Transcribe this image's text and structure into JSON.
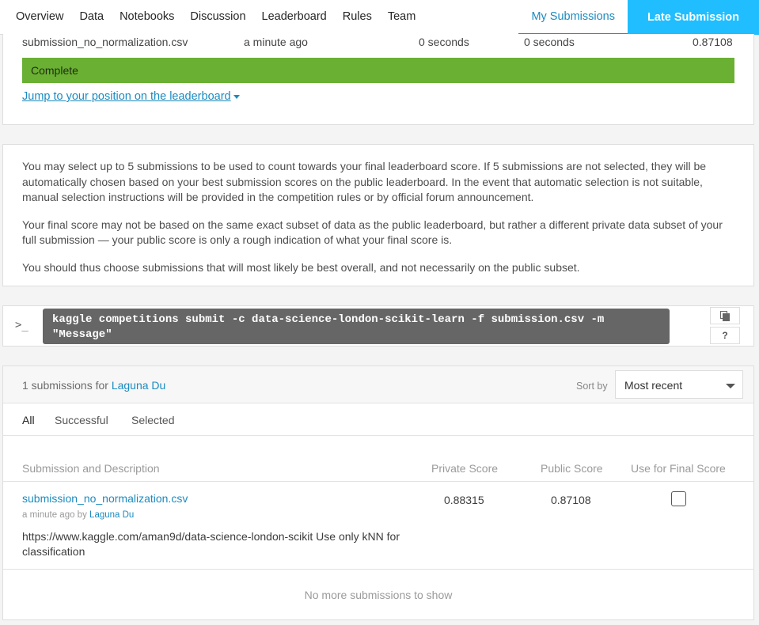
{
  "nav": {
    "tabs": [
      "Overview",
      "Data",
      "Notebooks",
      "Discussion",
      "Leaderboard",
      "Rules",
      "Team"
    ],
    "my_submissions": "My Submissions",
    "late_submission": "Late Submission"
  },
  "latest": {
    "filename": "submission_no_normalization.csv",
    "time": "a minute ago",
    "duration1": "0 seconds",
    "duration2": "0 seconds",
    "score": "0.87108",
    "status": "Complete",
    "jump_link": "Jump to your position on the leaderboard"
  },
  "info": {
    "p1": "You may select up to 5 submissions to be used to count towards your final leaderboard score. If 5 submissions are not selected, they will be automatically chosen based on your best submission scores on the public leaderboard. In the event that automatic selection is not suitable, manual selection instructions will be provided in the competition rules or by official forum announcement.",
    "p2": "Your final score may not be based on the same exact subset of data as the public leaderboard, but rather a different private data subset of your full submission — your public score is only a rough indication of what your final score is.",
    "p3": "You should thus choose submissions that will most likely be best overall, and not necessarily on the public subset."
  },
  "cli": {
    "prompt": ">_",
    "command": "kaggle competitions submit -c data-science-london-scikit-learn -f submission.csv -m \"Message\"",
    "help": "?"
  },
  "submissions": {
    "count_text": "1 submissions for",
    "user": "Laguna Du",
    "sort_label": "Sort by",
    "sort_value": "Most recent",
    "filters": [
      "All",
      "Successful",
      "Selected"
    ],
    "columns": {
      "desc": "Submission and Description",
      "private": "Private Score",
      "public": "Public Score",
      "final": "Use for Final Score"
    },
    "rows": [
      {
        "filename": "submission_no_normalization.csv",
        "meta_time": "a minute ago by",
        "meta_user": "Laguna Du",
        "description": "https://www.kaggle.com/aman9d/data-science-london-scikit Use only kNN for classification",
        "private_score": "0.88315",
        "public_score": "0.87108",
        "selected": false
      }
    ],
    "footer": "No more submissions to show"
  }
}
